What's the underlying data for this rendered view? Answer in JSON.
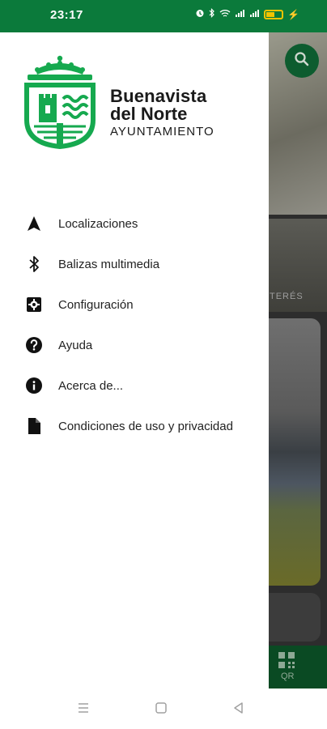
{
  "status": {
    "time": "23:17"
  },
  "logo": {
    "line1": "Buenavista",
    "line2": "del Norte",
    "line3": "AYUNTAMIENTO"
  },
  "menu": {
    "items": [
      {
        "label": "Localizaciones",
        "icon": "navigation-arrow-icon"
      },
      {
        "label": "Balizas multimedia",
        "icon": "bluetooth-icon"
      },
      {
        "label": "Configuración",
        "icon": "settings-icon"
      },
      {
        "label": "Ayuda",
        "icon": "help-icon"
      },
      {
        "label": "Acerca de...",
        "icon": "info-icon"
      },
      {
        "label": "Condiciones de uso y privacidad",
        "icon": "document-icon"
      }
    ]
  },
  "background": {
    "card_label": "TERÉS",
    "qr_label": "QR"
  },
  "colors": {
    "brand_green": "#0b7a3b",
    "logo_green": "#16a94f"
  }
}
